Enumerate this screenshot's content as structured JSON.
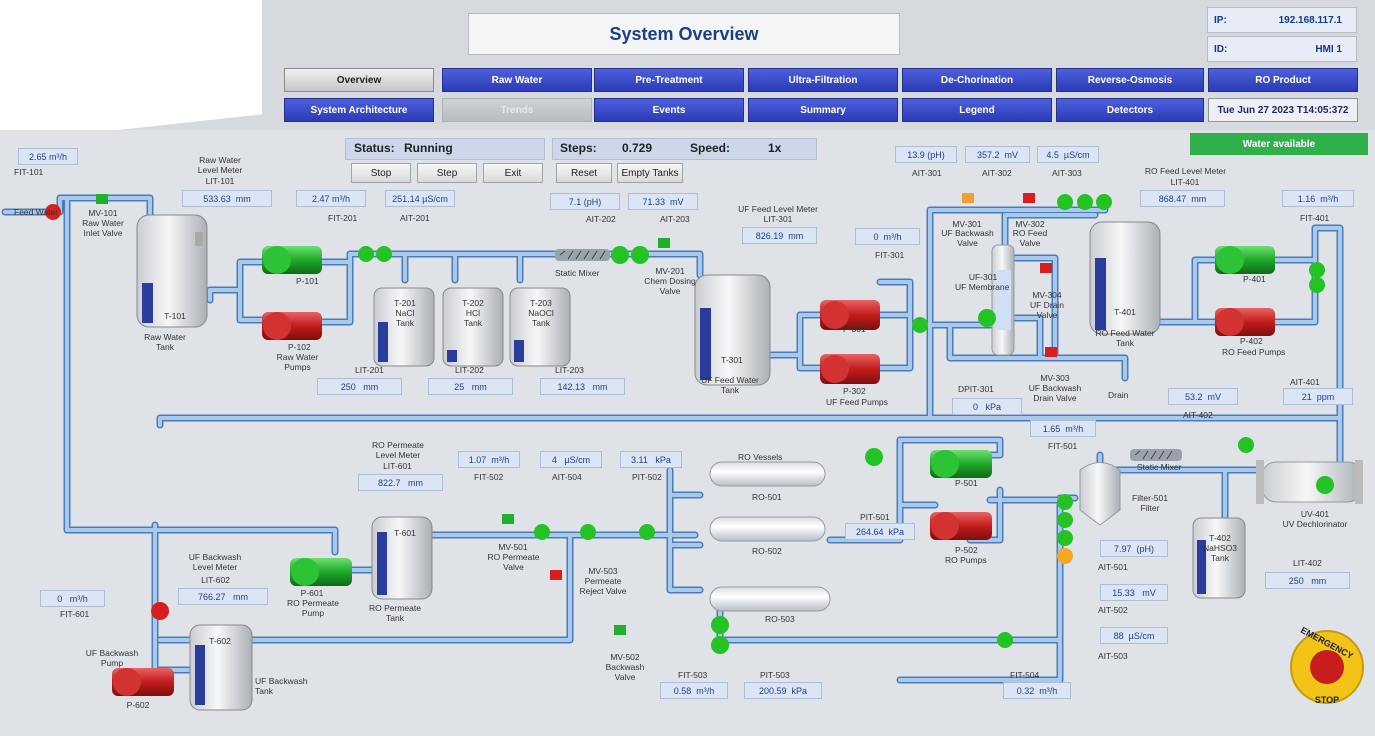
{
  "header": {
    "title": "System Overview",
    "ip_label": "IP:",
    "ip_value": "192.168.117.1",
    "id_label": "ID:",
    "id_value": "HMI 1"
  },
  "nav_row1": [
    "Overview",
    "Raw Water",
    "Pre-Treatment",
    "Ultra-Filtration",
    "De-Chorination",
    "Reverse-Osmosis",
    "RO Product"
  ],
  "nav_row2": [
    "System Architecture",
    "Trends",
    "Events",
    "Summary",
    "Legend",
    "Detectors"
  ],
  "datetime": "Tue Jun 27 2023 T14:05:372",
  "status": {
    "label": "Status:",
    "value": "Running",
    "stop": "Stop",
    "step": "Step",
    "exit": "Exit"
  },
  "steps": {
    "label": "Steps:",
    "value": "0.729",
    "speed_label": "Speed:",
    "speed_value": "1x",
    "reset": "Reset",
    "empty": "Empty Tanks"
  },
  "banner": "Water available",
  "raw": {
    "fit101_val": "2.65",
    "fit101_unit": "m³/h",
    "fit101": "FIT-101",
    "feed": "Feed Water",
    "mv101": "MV-101",
    "mv101_desc": "Raw Water Inlet Valve",
    "lit_title": "Raw Water Level Meter",
    "lit101": "LIT-101",
    "lit_val": "533.63",
    "lit_unit": "mm",
    "tank": "T-101",
    "tank_desc": "Raw Water Tank",
    "p101": "P-101",
    "p102": "P-102",
    "pumps": "Raw Water Pumps"
  },
  "pre": {
    "fit201_val": "2.47",
    "fit201_unit": "m³/h",
    "ait201_val": "251.14",
    "ait201_unit": "µS/cm",
    "fit201": "FIT-201",
    "ait201": "AIT-201",
    "ait202_val": "7.1",
    "ait202_unit": "(pH)",
    "ait203_val": "71.33",
    "ait203_unit": "mV",
    "ait202": "AIT-202",
    "ait203": "AIT-203",
    "mixer": "Static Mixer",
    "mv201": "MV-201",
    "mv201_desc": "Chem Dosing Valve",
    "t201": "T-201",
    "t201_chem": "NaCl",
    "t202": "T-202",
    "t202_chem": "HCl",
    "t203": "T-203",
    "t203_chem": "NaOCl",
    "tank_word": "Tank",
    "lit201": "LIT-201",
    "lit201_val": "250",
    "lit202": "LIT-202",
    "lit202_val": "25",
    "lit203": "LIT-203",
    "lit203_val": "142.13",
    "mm": "mm"
  },
  "uf": {
    "lit_title": "UF Feed Level Meter",
    "lit301": "LIT-301",
    "lit_val": "826.19",
    "lit_unit": "mm",
    "tank": "T-301",
    "tank_desc": "UF Feed Water Tank",
    "p301": "P-301",
    "p302": "P-302",
    "pumps": "UF Feed Pumps",
    "fit301_val": "0",
    "fit301_unit": "m³/h",
    "fit301": "FIT-301",
    "ait301_val": "13.9",
    "ait301_unit": "(pH)",
    "ait302_val": "357.2",
    "ait302_unit": "mV",
    "ait303_val": "4.5",
    "ait303_unit": "µS/cm",
    "ait301": "AIT-301",
    "ait302": "AIT-302",
    "ait303": "AIT-303",
    "mv301": "MV-301",
    "mv301_desc": "UF Backwash Valve",
    "mv302": "MV-302",
    "mv302_desc": "RO Feed Valve",
    "uf301": "UF-301",
    "uf301_desc": "UF Membrane",
    "mv304": "MV-304",
    "mv304_desc": "UF Drain Valve",
    "mv303": "MV-303",
    "mv303_desc": "UF Backwash Drain Valve",
    "dpit301": "DPIT-301",
    "dpit_val": "0",
    "dpit_unit": "kPa",
    "drain": "Drain"
  },
  "ro_feed": {
    "lit_title": "RO Feed Level Meter",
    "lit401": "LIT-401",
    "lit_val": "868.47",
    "lit_unit": "mm",
    "tank": "T-401",
    "tank_desc": "RO Feed Water Tank",
    "p401": "P-401",
    "p402": "P-402",
    "pumps": "RO Feed Pumps",
    "fit401_val": "1.16",
    "fit401_unit": "m³/h",
    "fit401": "FIT-401",
    "ait401": "AIT-401",
    "ait401_val": "21",
    "ait401_unit": "ppm",
    "ait402": "AIT-402",
    "ait402_val": "53.2",
    "ait402_unit": "mV"
  },
  "ro": {
    "fit501_val": "1.65",
    "fit501_unit": "m³/h",
    "fit501": "FIT-501",
    "mixer": "Static Mixer",
    "uv401": "UV-401",
    "uv_desc": "UV Dechlorinator",
    "filter": "Filter-501",
    "filter_desc": "Filter",
    "t402": "T-402",
    "t402_chem": "NaHSO3",
    "t402_tank": "Tank",
    "lit402": "LIT-402",
    "lit402_val": "250",
    "lit402_unit": "mm",
    "p501": "P-501",
    "p502": "P-502",
    "pumps": "RO Pumps",
    "ait501_val": "7.97",
    "ait501_unit": "(pH)",
    "ait501": "AIT-501",
    "ait502_val": "15.33",
    "ait502_unit": "mV",
    "ait502": "AIT-502",
    "ait503_val": "88",
    "ait503_unit": "µS/cm",
    "ait503": "AIT-503",
    "vessels": "RO Vessels",
    "ro501": "RO-501",
    "ro502": "RO-502",
    "ro503": "RO-503",
    "pit501": "PIT-501",
    "pit501_val": "264.64",
    "pit501_unit": "kPa",
    "fit502_val": "1.07",
    "fit502_unit": "m³/h",
    "fit502": "FIT-502",
    "ait504_val": "4",
    "ait504_unit": "µS/cm",
    "ait504": "AIT-504",
    "pit502_val": "3.11",
    "pit502_unit": "kPa",
    "pit502": "PIT-502",
    "mv501": "MV-501",
    "mv501_desc": "RO Permeate Valve",
    "mv503": "MV-503",
    "mv503_desc": "Permeate Reject Valve",
    "mv502": "MV-502",
    "mv502_desc": "Backwash Valve",
    "fit503": "FIT-503",
    "fit503_val": "0.58",
    "fit503_unit": "m³/h",
    "pit503": "PIT-503",
    "pit503_val": "200.59",
    "pit503_unit": "kPa",
    "fit504": "FIT-504",
    "fit504_val": "0.32",
    "fit504_unit": "m³/h"
  },
  "perm": {
    "lit_title": "RO Permeate Level Meter",
    "lit601": "LIT-601",
    "lit_val": "822.7",
    "lit_unit": "mm",
    "tank": "T-601",
    "tank_desc": "RO Permeate Tank",
    "p601": "P-601",
    "p601_desc": "RO Permeate Pump",
    "fit601": "FIT-601",
    "fit601_val": "0",
    "fit601_unit": "m³/h",
    "bw_title": "UF Backwash Level Meter",
    "lit602": "LIT-602",
    "bw_val": "766.27",
    "bw_unit": "mm",
    "t602": "T-602",
    "t602_desc": "UF Backwash Tank",
    "p602": "P-602",
    "p602_desc": "UF Backwash Pump"
  },
  "estop": {
    "top": "EMERGENCY",
    "bottom": "STOP"
  },
  "colors": {
    "pipe": "#8fb6e0",
    "pipe_edge": "#4a7cb8",
    "running": "#26c126",
    "stopped": "#d81e1e",
    "warning": "#f5a623",
    "nav_blue": "#2b3bb8"
  }
}
